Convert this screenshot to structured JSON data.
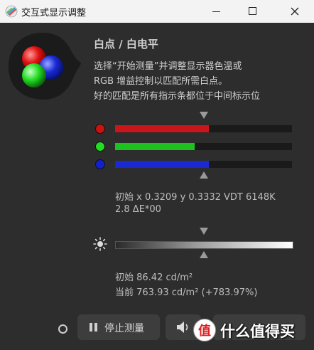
{
  "window": {
    "title": "交互式显示调整",
    "controls": [
      "minimize",
      "maximize",
      "close"
    ]
  },
  "logo": {
    "icon": "rgb-circles-logo"
  },
  "header": {
    "title": "白点 / 白电平"
  },
  "description": [
    "选择“开始测量”并调整显示器色温或",
    "RGB 增益控制以匹配所需白点。",
    "好的匹配是所有指示条都位于中间标示位"
  ],
  "rgb_bars": [
    {
      "channel": "red",
      "dot_color": "#cc1111",
      "bar_color": "#c8161a",
      "level": 0.53
    },
    {
      "channel": "green",
      "dot_color": "#22dd22",
      "bar_color": "#1ec21e",
      "level": 0.45
    },
    {
      "channel": "blue",
      "dot_color": "#1122cc",
      "bar_color": "#1a2ad0",
      "level": 0.53
    }
  ],
  "target_marker": 0.5,
  "initial_white": {
    "line1": "初始 x 0.3209 y 0.3332 VDT 6148K",
    "line2": "2.8 ΔE*00"
  },
  "brightness": {
    "icon": "sun-icon",
    "marker": 0.5,
    "initial": "初始 86.42 cd/m²",
    "current": "当前 763.93 cd/m² (+783.97%)"
  },
  "controls": {
    "status_icon": "ring-icon",
    "stop_label": "停止测量",
    "stop_icon": "pause-icon",
    "sound_icon": "speaker-icon"
  },
  "watermark": {
    "text": "什么值得买",
    "icon": "smzdm-logo"
  }
}
